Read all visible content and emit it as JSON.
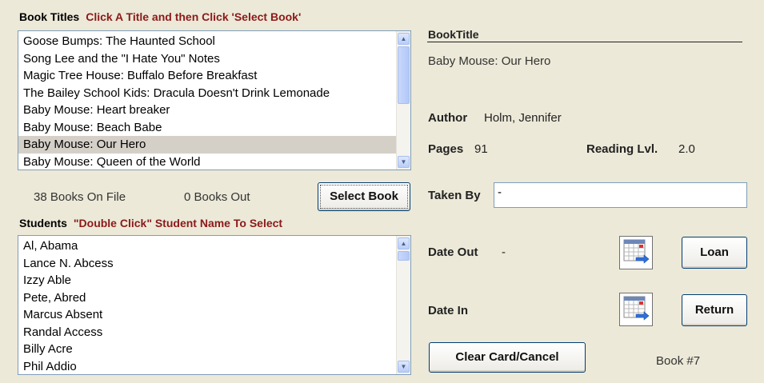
{
  "book_titles": {
    "heading": "Book Titles",
    "instruction": "Click A Title and then Click 'Select Book'",
    "items": [
      "Goose Bumps: The Haunted School",
      "Song Lee and the \"I Hate You\" Notes",
      "Magic Tree House: Buffalo Before Breakfast",
      "The Bailey School Kids: Dracula Doesn't Drink Lemonade",
      "Baby Mouse: Heart breaker",
      "Baby Mouse: Beach Babe",
      "Baby Mouse: Our Hero",
      "Baby Mouse: Queen of the World"
    ],
    "selected_index": 6
  },
  "stats": {
    "books_on_file": "38 Books On File",
    "books_out": "0 Books Out"
  },
  "select_book_label": "Select Book",
  "students": {
    "heading": "Students",
    "instruction": "\"Double Click\" Student Name To Select",
    "items": [
      "Al, Abama",
      "Lance N. Abcess",
      "Izzy Able",
      "Pete, Abred",
      "Marcus Absent",
      "Randal Access",
      "Billy Acre",
      "Phil Addio"
    ]
  },
  "detail": {
    "book_title_header": "BookTitle",
    "book_title_value": "Baby Mouse: Our Hero",
    "author_label": "Author",
    "author_value": "Holm, Jennifer",
    "pages_label": "Pages",
    "pages_value": "91",
    "reading_level_label": "Reading Lvl.",
    "reading_level_value": "2.0",
    "taken_by_label": "Taken By",
    "taken_by_value": "-",
    "date_out_label": "Date Out",
    "date_out_value": "-",
    "date_in_label": "Date In",
    "loan_label": "Loan",
    "return_label": "Return",
    "clear_label": "Clear Card/Cancel",
    "book_number": "Book #7"
  },
  "icons": {
    "calendar_out": "calendar-icon",
    "calendar_in": "calendar-icon"
  },
  "colors": {
    "background": "#ece9d8",
    "instruction_red": "#8b1a1a",
    "selection": "#d4d0c8"
  }
}
